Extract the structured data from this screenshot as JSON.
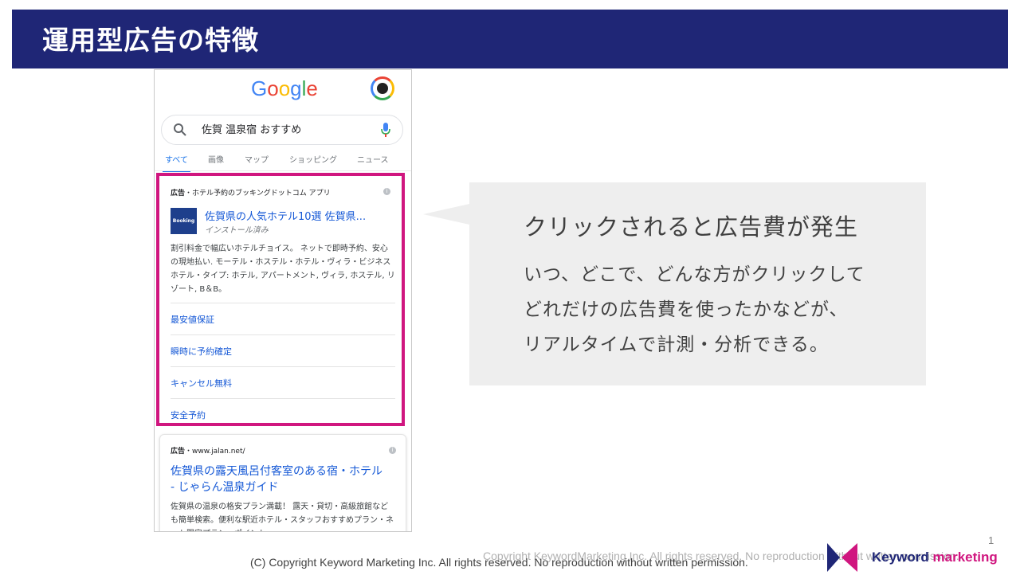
{
  "slide": {
    "title": "運用型広告の特徴",
    "page_number": "1"
  },
  "google_mock": {
    "logo_letters": [
      {
        "ch": "G",
        "color": "#4285f4"
      },
      {
        "ch": "o",
        "color": "#ea4335"
      },
      {
        "ch": "o",
        "color": "#fbbc05"
      },
      {
        "ch": "g",
        "color": "#4285f4"
      },
      {
        "ch": "l",
        "color": "#34a853"
      },
      {
        "ch": "e",
        "color": "#ea4335"
      }
    ],
    "search_query": "佐賀 温泉宿 おすすめ",
    "tabs": [
      "すべて",
      "画像",
      "マップ",
      "ショッピング",
      "ニュース"
    ],
    "ad1": {
      "label": "広告",
      "source": "・ホテル予約のブッキングドットコム アプリ",
      "logo_text": "Booking",
      "title": "佐賀県の人気ホテル10選 佐賀県...",
      "subtitle": "インストール済み",
      "description": "割引料金で幅広いホテルチョイス。 ネットで即時予約、安心の現地払い. モーテル・ホステル・ホテル・ヴィラ・ビジネスホテル・タイプ: ホテル, アパートメント, ヴィラ, ホステル, リゾート, B＆B。",
      "sitelinks": [
        "最安値保証",
        "瞬時に予約確定",
        "キャンセル無料",
        "安全予約"
      ]
    },
    "ad2": {
      "label": "広告",
      "source": "・www.jalan.net/",
      "title": "佐賀県の露天風呂付客室のある宿・ホテル - じゃらん温泉ガイド",
      "description": "佐賀県の温泉の格安プラン満載！ 露天・貸切・高級旅館なども簡単検索。便利な駅近ホテル・スタッフおすすめプラン・ネット限定プラン・ポイント"
    },
    "highlight_color": "#d0167f"
  },
  "callout": {
    "heading": "クリックされると広告費が発生",
    "lines": [
      "いつ、どこで、どんな方がクリックして",
      "どれだけの広告費を使ったかなどが、",
      "リアルタイムで計測・分析できる。"
    ]
  },
  "footer": {
    "copyright_main": "(C) Copyright Keyword Marketing Inc. All rights reserved. No reproduction without written permission.",
    "copyright_ghost": "Copyright KeywordMarketing Inc. All rights reserved. No reproduction without written permission.",
    "logo_word1": "Keyword",
    "logo_word2": "marketing"
  },
  "colors": {
    "title_bar": "#1f2676",
    "accent": "#d0167f",
    "link": "#1558d6"
  }
}
